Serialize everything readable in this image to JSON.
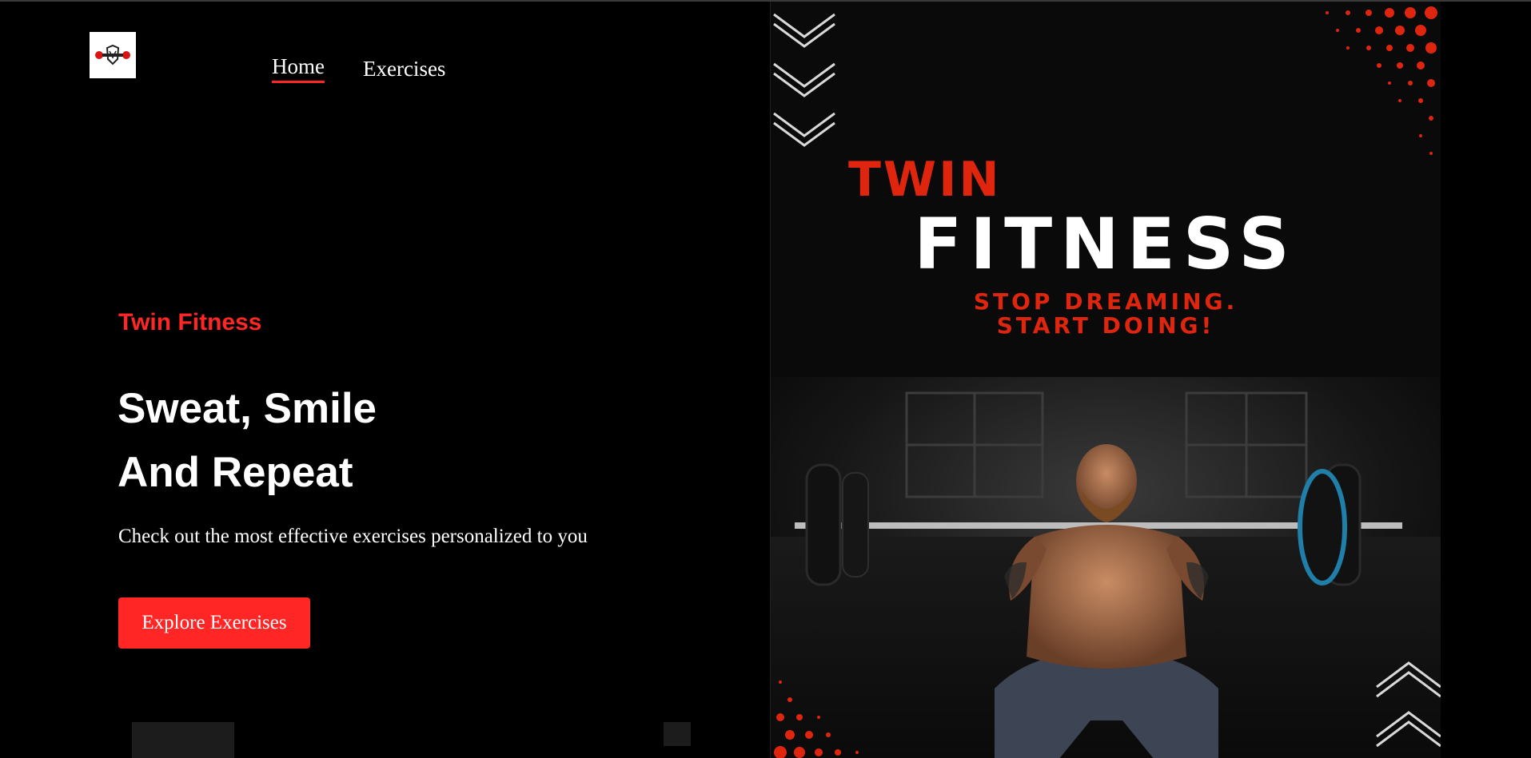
{
  "nav": {
    "logo_alt": "Twin Fitness logo",
    "home_label": "Home",
    "exercises_label": "Exercises"
  },
  "hero": {
    "brand": "Twin Fitness",
    "headline_line1": "Sweat, Smile",
    "headline_line2": "And Repeat",
    "subtitle": "Check out the most effective exercises personalized to you",
    "cta_label": "Explore Exercises"
  },
  "banner": {
    "title_top": "TWIN",
    "title_main": "FITNESS",
    "tagline_line1": "STOP DREAMING.",
    "tagline_line2": "START DOING!",
    "image_desc": "weightlifter-front-squat-photo"
  },
  "colors": {
    "accent": "#ff2625",
    "banner_red": "#e0250e",
    "background": "#000000",
    "text": "#ffffff"
  }
}
